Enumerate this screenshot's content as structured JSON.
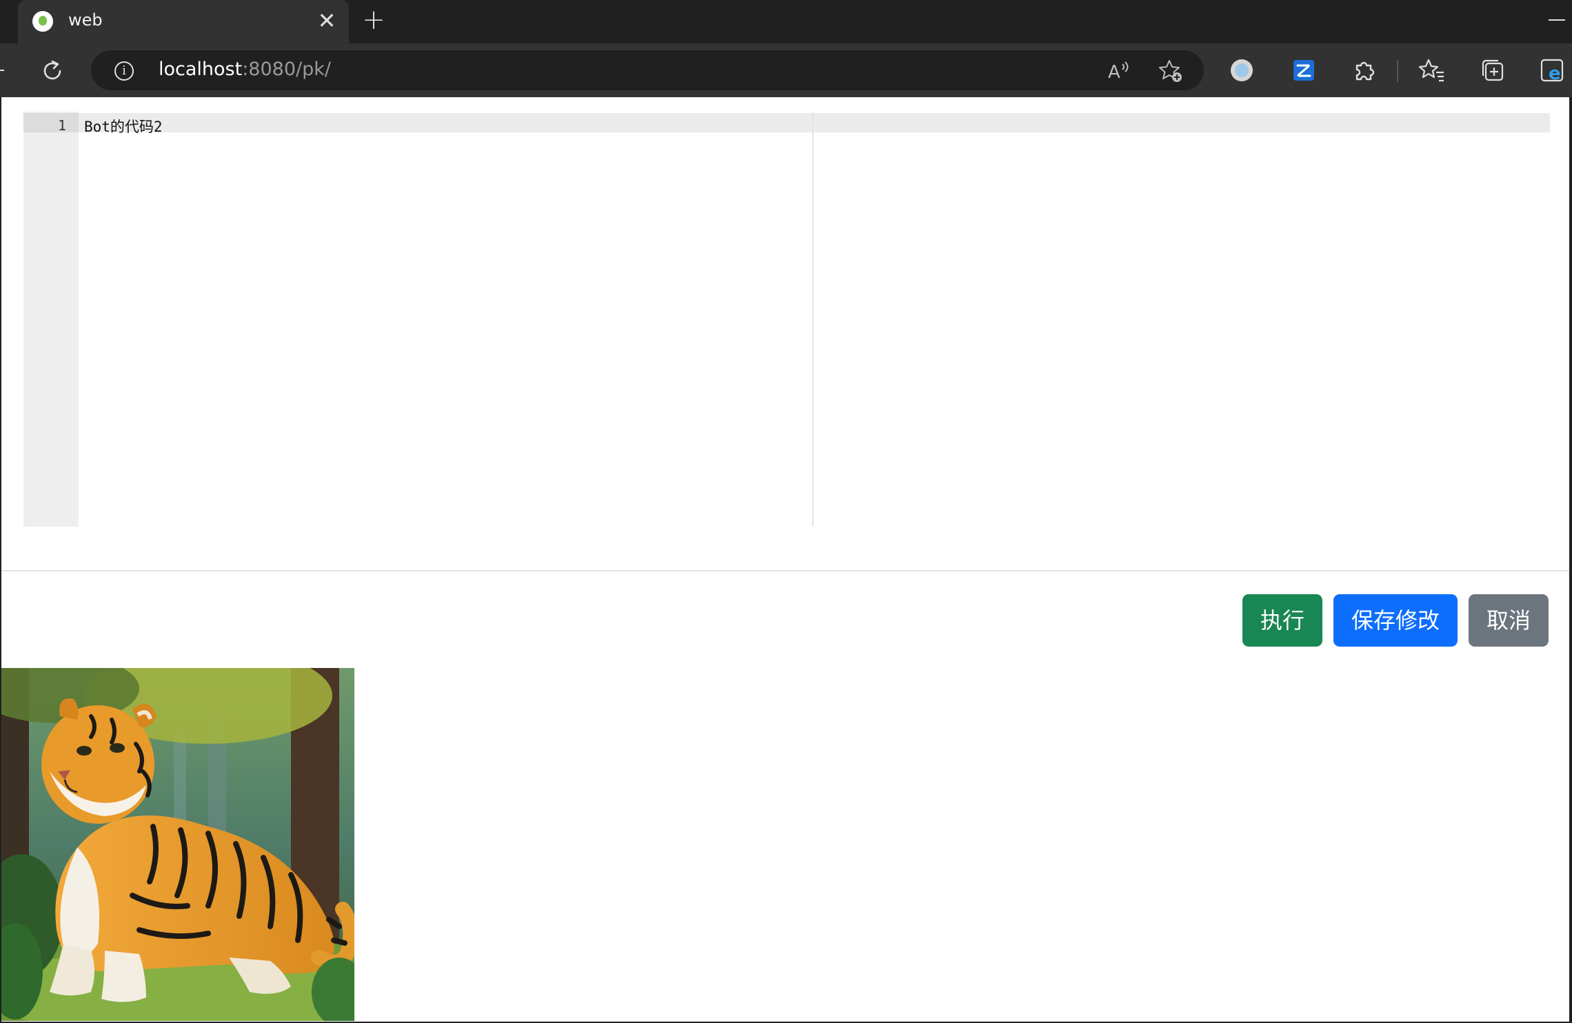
{
  "browser": {
    "tab": {
      "title": "web",
      "favicon": "app-favicon",
      "close_glyph": "✕"
    },
    "newtab_glyph": "+",
    "address": {
      "host": "localhost",
      "rest": ":8080/pk/"
    }
  },
  "icons": {
    "reload": "reload-icon",
    "info": "info-icon",
    "read_aloud": "read-aloud-icon",
    "add_favorite": "add-favorite-icon",
    "extensions": [
      "circle-extension-icon",
      "edit-extension-icon",
      "puzzle-icon"
    ],
    "favorites": "favorites-icon",
    "collections": "collections-icon",
    "ie_mode": "ie-mode-icon"
  },
  "editor": {
    "lines": [
      {
        "number": "1",
        "text": "Bot的代码2"
      }
    ]
  },
  "buttons": {
    "run": "执行",
    "save": "保存修改",
    "cancel": "取消"
  },
  "colors": {
    "run": "#198754",
    "save": "#0d6efd",
    "cancel": "#6c757d"
  }
}
